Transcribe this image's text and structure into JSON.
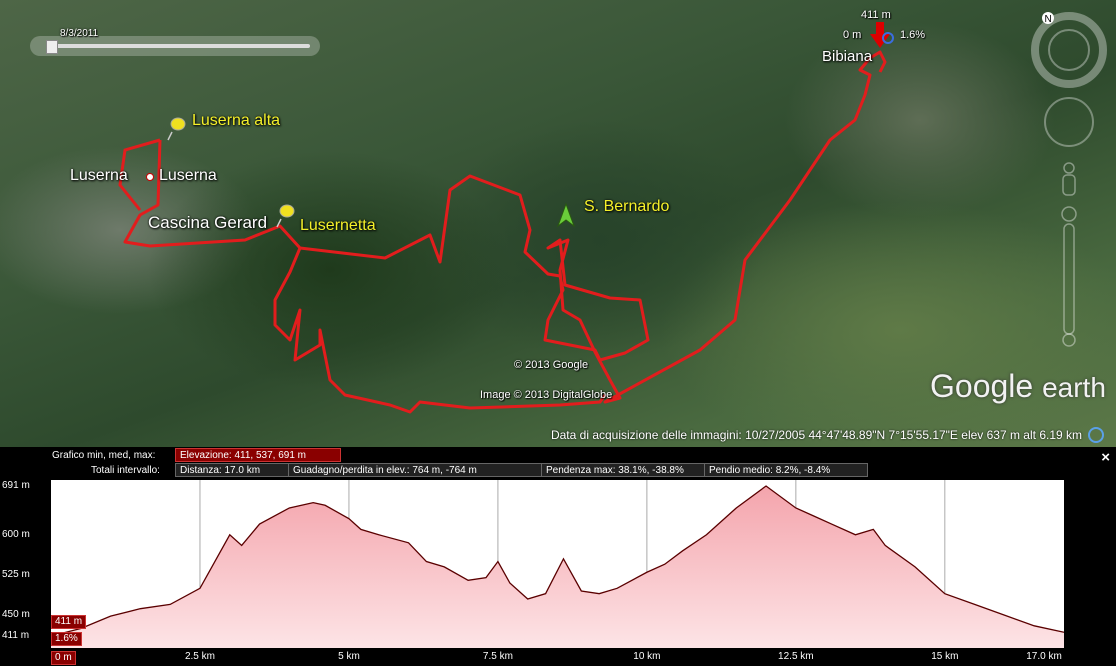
{
  "timeline": {
    "date": "8/3/2011"
  },
  "map": {
    "places": {
      "luserna_alta": "Luserna alta",
      "luserna_1": "Luserna",
      "luserna_2": "Luserna",
      "cascina": "Cascina Gerard",
      "lusernetta": "Lusernetta",
      "s_bernardo": "S. Bernardo",
      "bibiana": "Bibiana"
    },
    "cursor": {
      "elevation": "411 m",
      "distance": "0 m",
      "slope": "1.6%"
    },
    "copyright": [
      "© 2013 Google",
      "Image © 2013 DigitalGlobe"
    ],
    "brand": {
      "google": "Google",
      "earth": "earth"
    }
  },
  "statusbar": {
    "text": "Data di acquisizione delle immagini: 10/27/2005     44°47'48.89\"N     7°15'55.17\"E  elev   637 m      alt  6.19 km"
  },
  "profile": {
    "row1_label": "Grafico  min, med, max:",
    "elevation_box": "Elevazione: 411, 537, 691 m",
    "row2_label": "Totali intervallo:",
    "distance_box": "Distanza: 17.0 km",
    "gain_box": "Guadagno/perdita in elev.: 764 m, -764 m",
    "slope_box": "Pendenza max: 38.1%, -38.8%",
    "avg_slope_box": "Pendio medio: 8.2%, -8.4%",
    "close_label": "×",
    "cursor_elev": "411 m",
    "cursor_slope": "1.6%",
    "cursor_dist": "0 m"
  },
  "chart_data": {
    "type": "area",
    "x": [
      0,
      0.5,
      1,
      1.5,
      2,
      2.5,
      2.8,
      3.0,
      3.2,
      3.5,
      4,
      4.4,
      4.6,
      5,
      5.2,
      5.5,
      6,
      6.3,
      6.6,
      7,
      7.3,
      7.5,
      7.7,
      8,
      8.3,
      8.6,
      8.9,
      9.2,
      9.5,
      10,
      10.3,
      10.6,
      11,
      11.5,
      12,
      12.5,
      12.8,
      13.1,
      13.5,
      13.8,
      14,
      14.5,
      15,
      15.5,
      16,
      16.5,
      17.0
    ],
    "y": [
      411,
      425,
      448,
      462,
      470,
      500,
      560,
      600,
      580,
      620,
      650,
      660,
      655,
      630,
      610,
      600,
      585,
      550,
      540,
      515,
      520,
      550,
      510,
      480,
      490,
      555,
      495,
      490,
      500,
      530,
      545,
      570,
      600,
      650,
      691,
      650,
      635,
      620,
      600,
      610,
      580,
      540,
      490,
      470,
      450,
      430,
      418
    ],
    "xlabel": "",
    "ylabel": "",
    "x_ticks": [
      "2.5 km",
      "5 km",
      "7.5 km",
      "10 km",
      "12.5 km",
      "15 km",
      "17.0 km"
    ],
    "x_tick_values": [
      2.5,
      5,
      7.5,
      10,
      12.5,
      15,
      17.0
    ],
    "y_ticks": [
      "691 m",
      "600 m",
      "525 m",
      "450 m",
      "411 m"
    ],
    "y_tick_values": [
      691,
      600,
      525,
      450,
      411
    ],
    "xlim": [
      0,
      17.0
    ],
    "ylim": [
      411,
      691
    ],
    "grid": true,
    "colors": {
      "fill_top": "#f4a4ac",
      "fill_bottom": "#fde4e6",
      "line": "#5a0000",
      "grid": "#aaaaaa",
      "accent": "#cc0000"
    }
  }
}
